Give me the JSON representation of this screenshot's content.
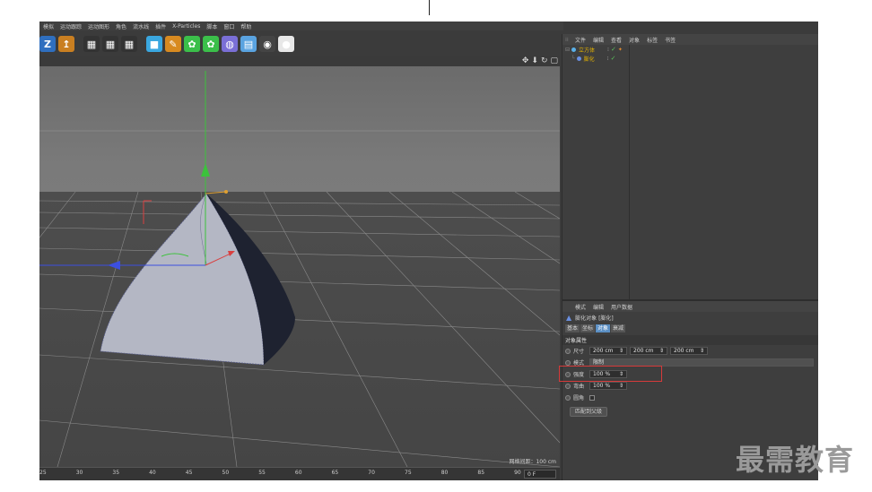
{
  "menu": [
    "模拟",
    "运动跟踪",
    "运动图形",
    "角色",
    "流水线",
    "插件",
    "X-Particles",
    "脚本",
    "窗口",
    "帮助"
  ],
  "toolbar": {
    "icons": [
      {
        "name": "z-axis-lock-icon",
        "glyph": "Z",
        "color": "#2f6fbf"
      },
      {
        "name": "world-coord-icon",
        "glyph": "↥",
        "color": "#c97f21"
      },
      {
        "name": "render-view-icon",
        "glyph": "▦",
        "color": "#333333"
      },
      {
        "name": "render-picture-viewer-icon",
        "glyph": "▦",
        "color": "#333333"
      },
      {
        "name": "render-settings-icon",
        "glyph": "▦",
        "color": "#333333"
      },
      {
        "name": "cube-primitive-icon",
        "glyph": "■",
        "color": "#3aa7e0"
      },
      {
        "name": "pen-spline-icon",
        "glyph": "✎",
        "color": "#d88a20"
      },
      {
        "name": "nurbs-generator-icon",
        "glyph": "✿",
        "color": "#3bbf4a"
      },
      {
        "name": "array-generator-icon",
        "glyph": "✿",
        "color": "#3bbf4a"
      },
      {
        "name": "deformer-icon",
        "glyph": "◍",
        "color": "#7a6fd6"
      },
      {
        "name": "floor-environment-icon",
        "glyph": "▤",
        "color": "#5aa3e0"
      },
      {
        "name": "camera-icon",
        "glyph": "◉",
        "color": "#444444"
      },
      {
        "name": "light-icon",
        "glyph": "●",
        "color": "#e8e8e8"
      }
    ]
  },
  "viewport": {
    "nav_icons": [
      "✥",
      "⬇",
      "↻",
      "▢"
    ],
    "grid_spacing_label": "网格间距：100 cm"
  },
  "timeline": {
    "ticks": [
      "25",
      "30",
      "35",
      "40",
      "45",
      "50",
      "55",
      "60",
      "65",
      "70",
      "75",
      "80",
      "85",
      "90"
    ],
    "current_frame": "0 F"
  },
  "object_manager": {
    "menu": [
      "文件",
      "编辑",
      "查看",
      "对象",
      "标签",
      "书签"
    ],
    "objects": [
      {
        "name": "立方体",
        "indent": 0,
        "color": "#5ab0e8"
      },
      {
        "name": "膨化",
        "indent": 1,
        "color": "#6a8fe0"
      }
    ]
  },
  "attribute_manager": {
    "menu": [
      "模式",
      "编辑",
      "用户数据"
    ],
    "title": "膨化对象 [膨化]",
    "tabs": [
      {
        "label": "基本",
        "active": false
      },
      {
        "label": "坐标",
        "active": false
      },
      {
        "label": "对象",
        "active": true
      },
      {
        "label": "衰减",
        "active": false
      }
    ],
    "section": "对象属性",
    "size": {
      "label": "尺寸",
      "x": "200 cm",
      "y": "200 cm",
      "z": "200 cm"
    },
    "mode": {
      "label": "模式",
      "value": "限制"
    },
    "strength": {
      "label": "强度",
      "value": "100 %"
    },
    "curvature": {
      "label": "弯曲",
      "value": "100 %"
    },
    "rounded": {
      "label": "圆角"
    },
    "fit_button": "匹配到父级"
  },
  "watermark": "最需教育",
  "colors": {
    "highlight": "#d63a3a",
    "axis_x": "#d94040",
    "axis_y": "#3cc23c",
    "axis_z": "#3c4fe0",
    "accent": "#5b8fc4"
  }
}
